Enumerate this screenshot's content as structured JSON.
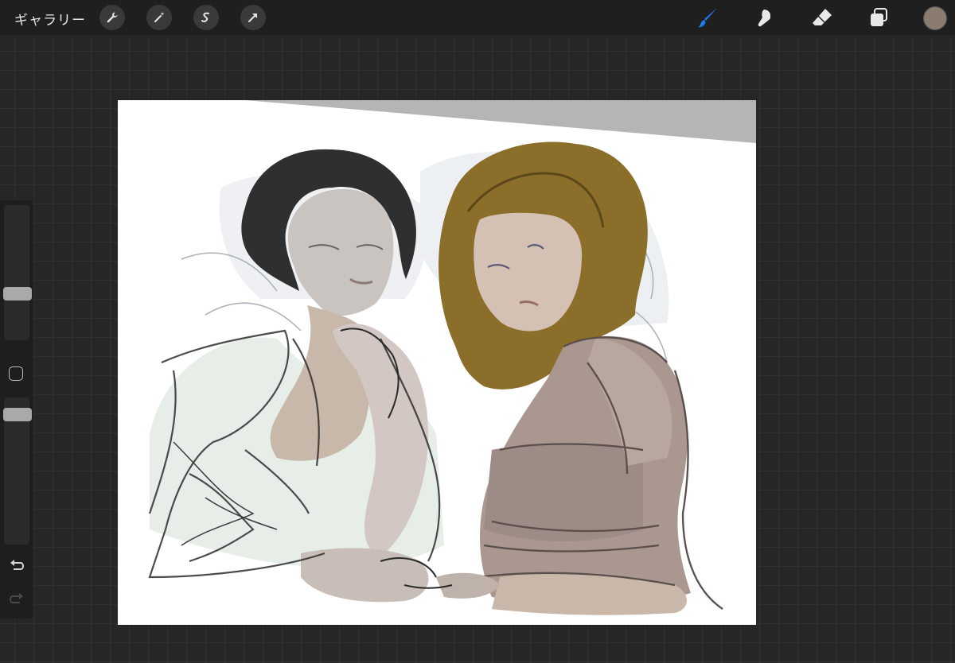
{
  "topbar": {
    "gallery_label": "ギャラリー",
    "left_tools": [
      "wrench-icon",
      "magic-wand-icon",
      "selection-s-icon",
      "transform-arrow-icon"
    ],
    "right_tools": [
      "brush-icon",
      "smudge-icon",
      "eraser-icon",
      "layers-icon"
    ],
    "active_tool": "brush-icon",
    "accent_color": "#1a7cf0",
    "current_color": "#8a7c6e"
  },
  "sidebar": {
    "size_slider_value": 0.45,
    "opacity_slider_value": 0.95,
    "undo_icon": "undo-icon",
    "redo_icon": "redo-icon"
  },
  "canvas": {
    "background": "#ffffff",
    "artwork": "sketch-of-two-women"
  }
}
